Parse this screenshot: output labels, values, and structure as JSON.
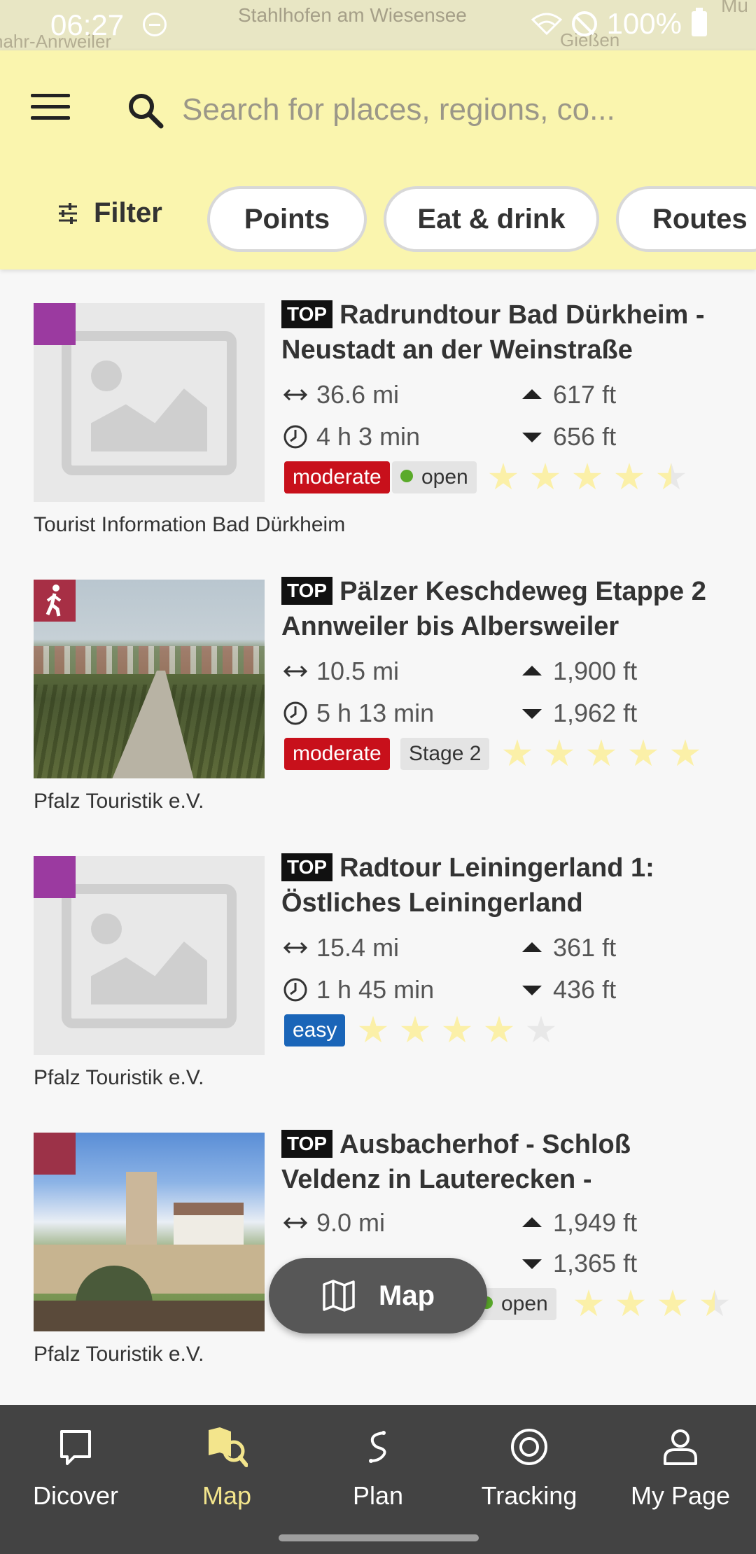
{
  "status_bar": {
    "time": "06:27",
    "battery": "100%",
    "map_labels": [
      "Stahlhofen am Wiesensee",
      "nahr-Anrweiler",
      "Gießen",
      "Mu"
    ]
  },
  "search": {
    "placeholder": "Search for places, regions, co..."
  },
  "filter_bar": {
    "filter_label": "Filter",
    "chips": [
      "Points",
      "Eat & drink",
      "Routes"
    ]
  },
  "colors": {
    "header_bg": "#faf5ae",
    "moderate": "#c8101b",
    "easy": "#1a65b8",
    "open_dot": "#5aaa2a",
    "cat_purple": "#9b3aa0",
    "cat_hiking": "#a72f45",
    "cat_dark_red": "#9c3248",
    "nav_active": "#f3e58c",
    "nav_bg": "#434343"
  },
  "items": [
    {
      "top": "TOP",
      "title": "Radrundtour Bad Dürkheim - Neustadt an der Weinstraße",
      "distance": "36.6 mi",
      "duration": "4 h 3 min",
      "ascent": "617 ft",
      "descent": "656 ft",
      "difficulty": "moderate",
      "status": "open",
      "rating": 4.5,
      "author": "Tourist Information Bad Dürkheim"
    },
    {
      "top": "TOP",
      "title": "Pälzer Keschdeweg Etappe 2 Annweiler bis Albersweiler",
      "distance": "10.5 mi",
      "duration": "5 h 13 min",
      "ascent": "1,900 ft",
      "descent": "1,962 ft",
      "difficulty": "moderate",
      "stage": "Stage 2",
      "rating": 5,
      "author": "Pfalz Touristik e.V."
    },
    {
      "top": "TOP",
      "title": "Radtour Leiningerland 1: Östliches Leiningerland",
      "distance": "15.4 mi",
      "duration": "1 h 45 min",
      "ascent": "361 ft",
      "descent": "436 ft",
      "difficulty": "easy",
      "rating": 4,
      "author": "Pfalz Touristik e.V."
    },
    {
      "top": "TOP",
      "title": "Ausbacherhof - Schloß Veldenz in Lauterecken -",
      "distance": "9.0 mi",
      "ascent": "1,949 ft",
      "descent": "1,365 ft",
      "status": "open",
      "rating": 3.5,
      "author": "Pfalz Touristik e.V."
    }
  ],
  "map_button": {
    "label": "Map"
  },
  "bottom_nav": [
    {
      "label": "Dicover",
      "icon": "discover-icon"
    },
    {
      "label": "Map",
      "icon": "map-icon",
      "active": true
    },
    {
      "label": "Plan",
      "icon": "plan-icon"
    },
    {
      "label": "Tracking",
      "icon": "tracking-icon"
    },
    {
      "label": "My Page",
      "icon": "user-icon"
    }
  ]
}
